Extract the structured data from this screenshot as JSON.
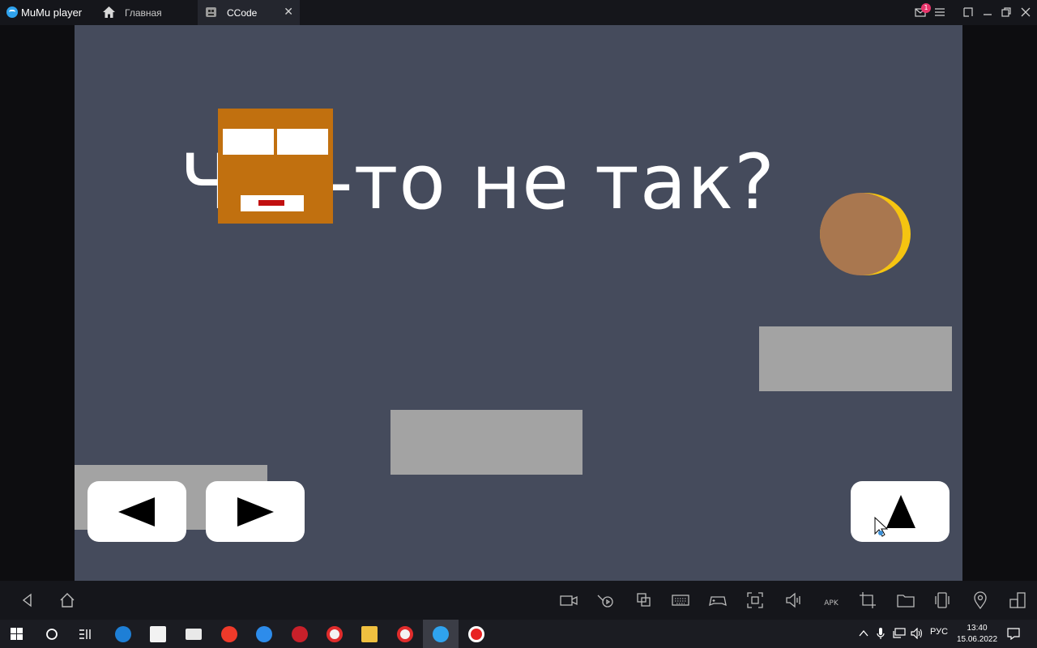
{
  "window": {
    "app_title": "MuMu player",
    "notification_count": "1",
    "tabs": [
      {
        "label": "Главная",
        "icon": "home-icon"
      },
      {
        "label": "CCode",
        "icon": "app-icon",
        "close": "✕"
      }
    ]
  },
  "game": {
    "caption": "Что-то не так?",
    "colors": {
      "background": "#454b5c",
      "player": "#c1700f",
      "coin_rim": "#f5c411",
      "coin_face": "#a9774f",
      "platform": "#a3a3a3",
      "mouth": "#c10f0f"
    },
    "controls": [
      {
        "name": "left-button",
        "icon": "arrow-left-icon"
      },
      {
        "name": "right-button",
        "icon": "arrow-right-icon"
      },
      {
        "name": "jump-button",
        "icon": "arrow-up-icon"
      }
    ]
  },
  "emulator_toolbar": {
    "icons": [
      "back-icon",
      "home-icon",
      "record-icon",
      "operation-recorder-icon",
      "multi-instance-icon",
      "keyboard-icon",
      "gamepad-icon",
      "fullscreen-icon",
      "volume-icon",
      "apk-install-icon",
      "crop-icon",
      "folder-icon",
      "rotate-icon",
      "location-icon",
      "sync-icon"
    ],
    "apk_label": "APK"
  },
  "taskbar": {
    "language": "РУС",
    "time": "13:40",
    "date": "15.06.2022"
  }
}
